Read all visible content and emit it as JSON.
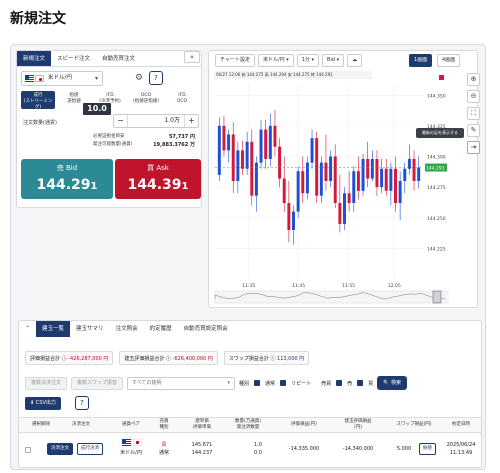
{
  "page_title": "新規注文",
  "order_panel": {
    "tabs": [
      "新規注文",
      "スピード注文",
      "自動売買注文"
    ],
    "pair": "米ドル/円",
    "order_types": [
      [
        "成行",
        "(ストリーミング)"
      ],
      [
        "指値",
        "逆指値"
      ],
      [
        "IFD",
        "(決済予約)"
      ],
      [
        "OCO",
        "(指値逆指値)"
      ],
      [
        "IFD",
        "OCO"
      ]
    ],
    "qty_label": "注文数量(通貨)",
    "qty_value": "1.0万",
    "margin_labels": [
      "必要証拠金目安",
      "発注可能数量(通貨)"
    ],
    "margin_values": [
      "57,737 円",
      "19,883.3762 万"
    ],
    "sell": {
      "label": "売 Bid",
      "price_main": "144.29",
      "price_small": "1"
    },
    "buy": {
      "label": "買 Ask",
      "price_main": "144.39",
      "price_small": "1"
    },
    "spread": "10.0"
  },
  "chart": {
    "toolbar": [
      "チャート設定",
      "米ドル/円",
      "1分",
      "Bid",
      "1画面",
      "4画面"
    ],
    "ohlc": "06/27 12:06  始 144.275  高 144.294  安 144.275  終 144.291",
    "tooltip": "最新の足を表示する",
    "colors": {
      "up": "#1f4fd6",
      "down": "#d41a3a",
      "last": "#2ea84a"
    }
  },
  "chart_data": {
    "type": "candlestick",
    "y_ticks": [
      "144.350",
      "144.325",
      "144.300",
      "144.275",
      "144.250",
      "144.225"
    ],
    "x_ticks": [
      "11:35",
      "11:45",
      "11:55",
      "12:05"
    ],
    "last_price": "144.291",
    "ylim": [
      144.2,
      144.36
    ],
    "candles": [
      [
        144.285,
        144.332,
        144.28,
        144.325
      ],
      [
        144.325,
        144.333,
        144.3,
        144.305
      ],
      [
        144.305,
        144.322,
        144.295,
        144.318
      ],
      [
        144.318,
        144.328,
        144.27,
        144.28
      ],
      [
        144.28,
        144.312,
        144.27,
        144.305
      ],
      [
        144.305,
        144.313,
        144.285,
        144.29
      ],
      [
        144.29,
        144.32,
        144.285,
        144.312
      ],
      [
        144.312,
        144.322,
        144.26,
        144.268
      ],
      [
        144.268,
        144.3,
        144.255,
        144.295
      ],
      [
        144.295,
        144.33,
        144.29,
        144.322
      ],
      [
        144.322,
        144.33,
        144.29,
        144.298
      ],
      [
        144.298,
        144.335,
        144.292,
        144.325
      ],
      [
        144.325,
        144.338,
        144.3,
        144.308
      ],
      [
        144.308,
        144.315,
        144.275,
        144.282
      ],
      [
        144.282,
        144.3,
        144.255,
        144.262
      ],
      [
        144.262,
        144.28,
        144.23,
        144.24
      ],
      [
        144.24,
        144.26,
        144.228,
        144.255
      ],
      [
        144.255,
        144.292,
        144.25,
        144.288
      ],
      [
        144.288,
        144.3,
        144.262,
        144.27
      ],
      [
        144.27,
        144.3,
        144.265,
        144.295
      ],
      [
        144.295,
        144.322,
        144.29,
        144.315
      ],
      [
        144.315,
        144.32,
        144.262,
        144.268
      ],
      [
        144.268,
        144.3,
        144.262,
        144.295
      ],
      [
        144.295,
        144.318,
        144.272,
        144.28
      ],
      [
        144.28,
        144.305,
        144.275,
        144.3
      ],
      [
        144.3,
        144.31,
        144.258,
        144.262
      ],
      [
        144.262,
        144.285,
        144.238,
        144.245
      ],
      [
        144.245,
        144.275,
        144.24,
        144.27
      ],
      [
        144.27,
        144.288,
        144.255,
        144.262
      ],
      [
        144.262,
        144.292,
        144.255,
        144.288
      ],
      [
        144.288,
        144.3,
        144.265,
        144.272
      ],
      [
        144.272,
        144.302,
        144.268,
        144.298
      ],
      [
        144.298,
        144.312,
        144.275,
        144.282
      ],
      [
        144.282,
        144.305,
        144.28,
        144.298
      ],
      [
        144.298,
        144.305,
        144.268,
        144.275
      ],
      [
        144.275,
        144.298,
        144.27,
        144.29
      ],
      [
        144.29,
        144.298,
        144.268,
        144.272
      ],
      [
        144.272,
        144.295,
        144.26,
        144.29
      ],
      [
        144.29,
        144.3,
        144.255,
        144.262
      ],
      [
        144.262,
        144.288,
        144.248,
        144.28
      ],
      [
        144.28,
        144.295,
        144.27,
        144.29
      ],
      [
        144.29,
        144.31,
        144.285,
        144.298
      ],
      [
        144.298,
        144.305,
        144.272,
        144.28
      ],
      [
        144.28,
        144.3,
        144.274,
        144.291
      ]
    ]
  },
  "positions": {
    "tabs": [
      "建玉一覧",
      "建玉サマリ",
      "注文照会",
      "約定履歴",
      "自動売買設定照会"
    ],
    "summary": [
      {
        "label": "評価損益合計",
        "value": "-426,287,000 円",
        "tone": "neg"
      },
      {
        "label": "建玉評価損益合計",
        "value": "-626,400,000 円",
        "tone": "neg"
      },
      {
        "label": "スワップ損益合計",
        "value": "113,000 円",
        "tone": "pos"
      }
    ],
    "filters": {
      "btn1": "複数決済注文",
      "btn2": "複数スワップ振替",
      "select": "すべての銘柄",
      "kind_label": "種別",
      "kind1": "通常",
      "kind2": "リピート",
      "side_label": "売買",
      "side1": "売",
      "side2": "買",
      "search": "検索"
    },
    "csv": "CSV出力",
    "headers": [
      "",
      "決済注文",
      "通貨ペア",
      "売買\n種別",
      "建単価\n評価単価",
      "数量(万通貨)\n発注済数量",
      "評価損益(円)",
      "建玉評価損益\n(円)",
      "スワップ損益(円)",
      "約定日時"
    ],
    "row": {
      "btn_settle": "決済注文",
      "btn_settle2": "成行決済",
      "pair": "米ドル/円",
      "side": "買",
      "kind": "通常",
      "price1": "145.671",
      "price2": "144.237",
      "qty1": "1.0",
      "qty2": "0.0",
      "pl": "-14,335.000",
      "pos_pl": "-14,340.000",
      "swap": "5.000",
      "swap_btn": "振替",
      "date": "2025/06/24",
      "time": "11:13:49"
    },
    "top_btn": "選択解除"
  }
}
